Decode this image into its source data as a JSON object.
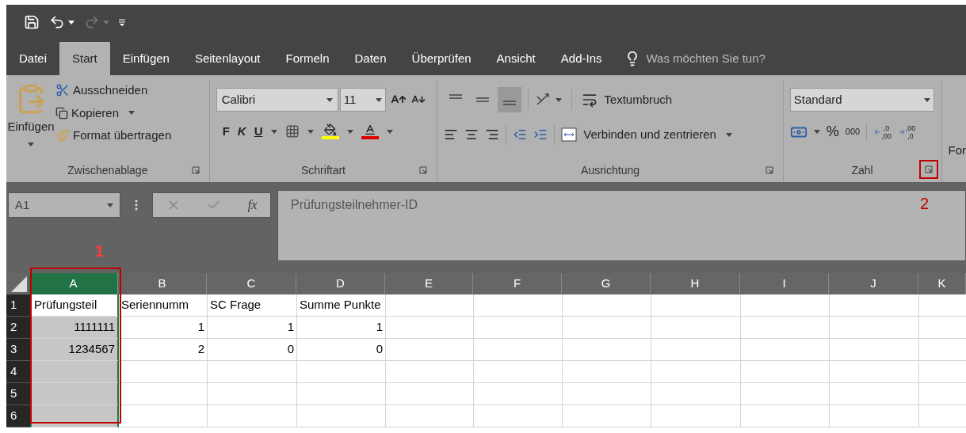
{
  "quick_access": {
    "undo_enabled": true,
    "redo_enabled": false
  },
  "tabs": [
    {
      "label": "Datei",
      "selected": false
    },
    {
      "label": "Start",
      "selected": true
    },
    {
      "label": "Einfügen",
      "selected": false
    },
    {
      "label": "Seitenlayout",
      "selected": false
    },
    {
      "label": "Formeln",
      "selected": false
    },
    {
      "label": "Daten",
      "selected": false
    },
    {
      "label": "Überprüfen",
      "selected": false
    },
    {
      "label": "Ansicht",
      "selected": false
    },
    {
      "label": "Add-Ins",
      "selected": false
    }
  ],
  "tell_me": {
    "placeholder": "Was möchten Sie tun?"
  },
  "ribbon": {
    "clipboard": {
      "title": "Zwischenablage",
      "paste": "Einfügen",
      "cut": "Ausschneiden",
      "copy": "Kopieren",
      "format_painter": "Format übertragen"
    },
    "font": {
      "title": "Schriftart",
      "font_name": "Calibri",
      "font_size": "11",
      "bold": "F",
      "italic": "K",
      "underline": "U"
    },
    "alignment": {
      "title": "Ausrichtung",
      "vertical": [
        {
          "selected": false
        },
        {
          "selected": false
        },
        {
          "selected": true
        }
      ],
      "wrap": "Textumbruch",
      "merge": "Verbinden und zentrieren"
    },
    "number": {
      "title": "Zahl",
      "format": "Standard",
      "percent": "%",
      "thousands": "000",
      "increase_decimal": [
        ",0",
        ",00"
      ],
      "decrease_decimal": [
        ",00",
        ",0"
      ]
    },
    "styles": {
      "title": "For"
    }
  },
  "formula_bar": {
    "name_box": "A1",
    "fx": "fx",
    "formula": "Prüfungsteilnehmer-ID"
  },
  "sheet": {
    "columns": [
      {
        "label": "A",
        "selected": true
      },
      {
        "label": "B",
        "selected": false
      },
      {
        "label": "C",
        "selected": false
      },
      {
        "label": "D",
        "selected": false
      },
      {
        "label": "E",
        "selected": false
      },
      {
        "label": "F",
        "selected": false
      },
      {
        "label": "G",
        "selected": false
      },
      {
        "label": "H",
        "selected": false
      },
      {
        "label": "I",
        "selected": false
      },
      {
        "label": "J",
        "selected": false
      },
      {
        "label": "K",
        "selected": false
      }
    ],
    "rows": [
      {
        "label": "1",
        "cells": [
          {
            "text": "Prüfungsteil",
            "kind": "text"
          },
          {
            "text": "Seriennumm",
            "kind": "text"
          },
          {
            "text": "SC Frage",
            "kind": "text"
          },
          {
            "text": "Summe Punkte",
            "kind": "text"
          }
        ]
      },
      {
        "label": "2",
        "cells": [
          {
            "text": "1111111",
            "kind": "number"
          },
          {
            "text": "1",
            "kind": "number"
          },
          {
            "text": "1",
            "kind": "number"
          },
          {
            "text": "1",
            "kind": "number"
          }
        ]
      },
      {
        "label": "3",
        "cells": [
          {
            "text": "1234567",
            "kind": "number"
          },
          {
            "text": "2",
            "kind": "number"
          },
          {
            "text": "0",
            "kind": "number"
          },
          {
            "text": "0",
            "kind": "number"
          }
        ]
      },
      {
        "label": "4",
        "cells": []
      },
      {
        "label": "5",
        "cells": []
      },
      {
        "label": "6",
        "cells": []
      }
    ]
  },
  "annotations": [
    {
      "label": "1"
    },
    {
      "label": "2"
    }
  ]
}
